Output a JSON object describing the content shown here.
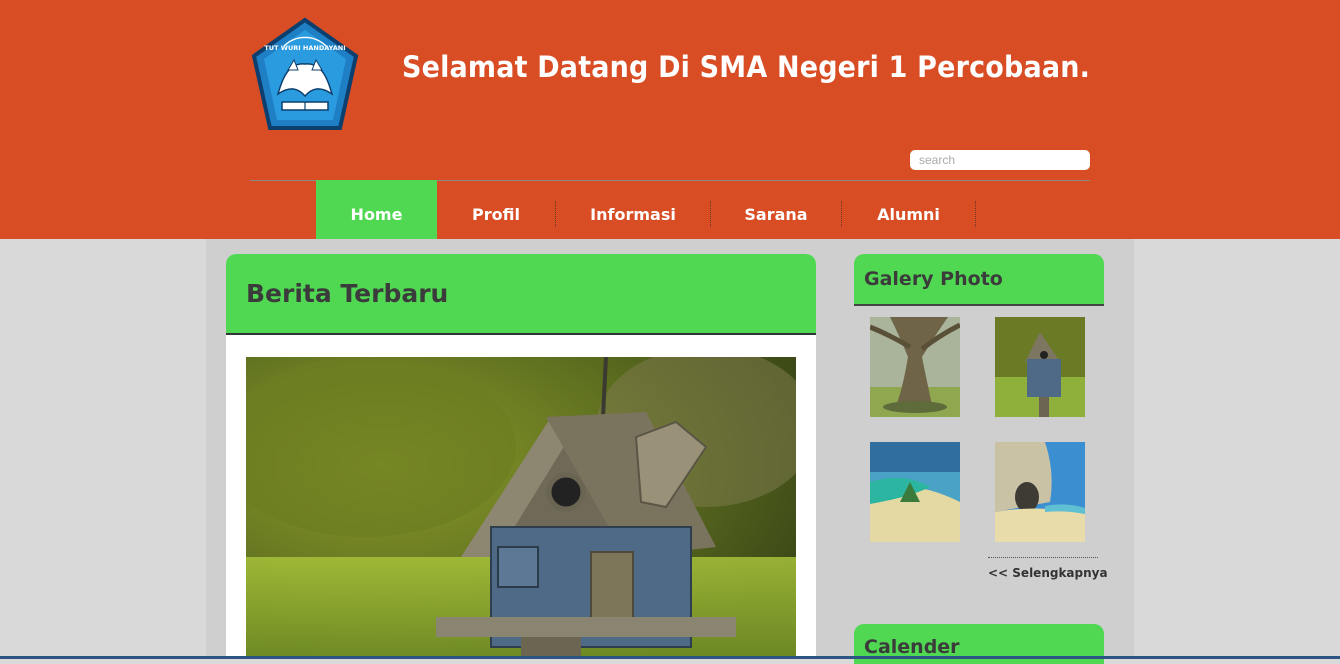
{
  "header": {
    "site_title": "Selamat Datang Di SMA Negeri 1 Percobaan.",
    "logo": {
      "icon": "tut-wuri-handayani-logo",
      "motto": "TUT WURI HANDAYANI"
    },
    "search": {
      "placeholder": "search",
      "value": ""
    }
  },
  "nav": {
    "items": [
      {
        "label": "Home",
        "active": true
      },
      {
        "label": "Profil",
        "active": false
      },
      {
        "label": "Informasi",
        "active": false
      },
      {
        "label": "Sarana",
        "active": false
      },
      {
        "label": "Alumni",
        "active": false
      }
    ]
  },
  "news": {
    "title": "Berita Terbaru",
    "image": "birdhouse-photo"
  },
  "gallery": {
    "title": "Galery Photo",
    "thumbnails": [
      {
        "icon": "tree-photo"
      },
      {
        "icon": "birdhouse-photo"
      },
      {
        "icon": "beach-photo"
      },
      {
        "icon": "sea-cave-photo"
      }
    ],
    "more_label": "<< Selengkapnya"
  },
  "calendar": {
    "title": "Calender"
  },
  "colors": {
    "header_bg": "#d84d24",
    "accent_green": "#51d853",
    "page_bg": "#d9d9d9",
    "content_bg": "#cfcfcf"
  }
}
